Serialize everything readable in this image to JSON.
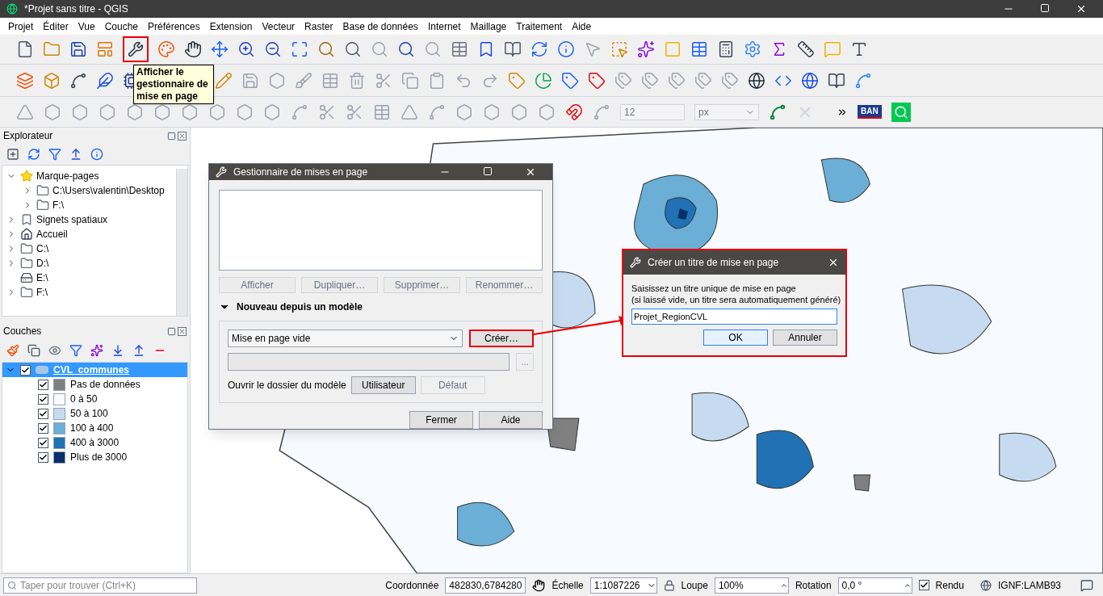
{
  "window": {
    "title": "*Projet sans titre - QGIS"
  },
  "menu": [
    "Projet",
    "Éditer",
    "Vue",
    "Couche",
    "Préférences",
    "Extension",
    "Vecteur",
    "Raster",
    "Base de données",
    "Internet",
    "Maillage",
    "Traitement",
    "Aide"
  ],
  "tooltip": {
    "text": "Afficher le gestionnaire de mise en page"
  },
  "snapping": {
    "tolerance": "12",
    "unit": "px"
  },
  "ban_badge": "BAN",
  "explorer": {
    "title": "Explorateur",
    "items": [
      {
        "label": "Marque-pages",
        "kind": "star",
        "expanded": true,
        "children": [
          {
            "label": "C:\\Users\\valentin\\Desktop",
            "kind": "folder",
            "expanded": false
          },
          {
            "label": "F:\\",
            "kind": "folder",
            "expanded": false
          }
        ]
      },
      {
        "label": "Signets spatiaux",
        "kind": "bookmark",
        "expanded": false
      },
      {
        "label": "Accueil",
        "kind": "home",
        "expanded": false
      },
      {
        "label": "C:\\",
        "kind": "folder",
        "expanded": false
      },
      {
        "label": "D:\\",
        "kind": "folder",
        "expanded": false
      },
      {
        "label": "E:\\",
        "kind": "drive"
      },
      {
        "label": "F:\\",
        "kind": "folder",
        "expanded": false
      }
    ]
  },
  "layers": {
    "title": "Couches",
    "items": [
      {
        "name": "CVL_communes",
        "checked": true,
        "expanded": true,
        "selected": true,
        "children": [
          {
            "label": "Pas de données",
            "color": "#808080",
            "checked": true,
            "selected": false
          },
          {
            "label": "0 à 50",
            "color": "#f7fbff",
            "checked": true,
            "selected": false
          },
          {
            "label": "50 à 100",
            "color": "#c6dbef",
            "checked": true,
            "selected": false
          },
          {
            "label": "100 à 400",
            "color": "#6baed6",
            "checked": true,
            "selected": false
          },
          {
            "label": "400 à 3000",
            "color": "#2171b5",
            "checked": true,
            "selected": false
          },
          {
            "label": "Plus de 3000",
            "color": "#08306b",
            "checked": true,
            "selected": false
          }
        ]
      }
    ]
  },
  "layout_manager": {
    "title": "Gestionnaire de mises en page",
    "actions": [
      {
        "label": "Afficher",
        "disabled": true
      },
      {
        "label": "Dupliquer…",
        "disabled": true
      },
      {
        "label": "Supprimer…",
        "disabled": true
      },
      {
        "label": "Renommer…",
        "disabled": true
      }
    ],
    "section": {
      "title": "Nouveau depuis un modèle",
      "expanded": true
    },
    "template": "Mise en page vide",
    "create_button": "Créer…",
    "browse_button": "…",
    "folder_label": "Ouvrir le dossier du modèle",
    "folder_buttons": [
      {
        "label": "Utilisateur",
        "disabled": false
      },
      {
        "label": "Défaut",
        "disabled": true
      }
    ],
    "buttons": [
      "Fermer",
      "Aide"
    ]
  },
  "title_dialog": {
    "title": "Créer un titre de mise en page",
    "prompt": [
      "Saisissez un titre unique de mise en page",
      "(si laissé vide, un titre sera automatiquement généré)"
    ],
    "value": "Projet_RegionCVL",
    "buttons": [
      "OK",
      "Annuler"
    ]
  },
  "status_bar": {
    "search_placeholder": "Taper pour trouver (Ctrl+K)",
    "coordinate_label": "Coordonnée",
    "coordinate": "482830,6784280",
    "scale_label": "Échelle",
    "scale": "1:1087226",
    "magnifier_label": "Loupe",
    "magnifier": "100%",
    "rotation_label": "Rotation",
    "rotation": "0,0 °",
    "render_label": "Rendu",
    "render": true,
    "crs": "IGNF:LAMB93"
  }
}
